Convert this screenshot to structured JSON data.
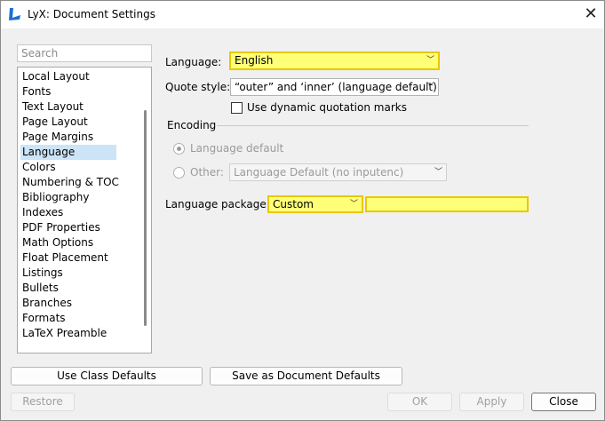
{
  "window": {
    "title": "LyX: Document Settings",
    "app_icon": "lyx-logo-icon",
    "close_glyph": "✕"
  },
  "search": {
    "placeholder": "Search"
  },
  "sidebar": {
    "items": [
      {
        "label": "Local Layout"
      },
      {
        "label": "Fonts"
      },
      {
        "label": "Text Layout"
      },
      {
        "label": "Page Layout"
      },
      {
        "label": "Page Margins"
      },
      {
        "label": "Language",
        "selected": true
      },
      {
        "label": "Colors"
      },
      {
        "label": "Numbering & TOC"
      },
      {
        "label": "Bibliography"
      },
      {
        "label": "Indexes"
      },
      {
        "label": "PDF Properties"
      },
      {
        "label": "Math Options"
      },
      {
        "label": "Float Placement"
      },
      {
        "label": "Listings"
      },
      {
        "label": "Bullets"
      },
      {
        "label": "Branches"
      },
      {
        "label": "Formats"
      },
      {
        "label": "LaTeX Preamble"
      }
    ]
  },
  "language": {
    "label": "Language:",
    "value": "English"
  },
  "quote": {
    "label": "Quote style:",
    "value": "“outer” and ‘inner’ (language default)",
    "dynamic_label": "Use dynamic quotation marks",
    "dynamic_checked": false
  },
  "encoding": {
    "group_label": "Encoding",
    "default_label": "Language default",
    "other_label": "Other:",
    "other_value": "Language Default (no inputenc)"
  },
  "package": {
    "label": "Language package:",
    "value": "Custom",
    "custom_text": ""
  },
  "buttons": {
    "class_defaults": "Use Class Defaults",
    "save_defaults": "Save as Document Defaults",
    "restore": "Restore",
    "ok": "OK",
    "apply": "Apply",
    "close": "Close"
  },
  "colors": {
    "highlight": "#ffff78",
    "highlight_border": "#e8c800",
    "selection": "#cce4f7"
  }
}
